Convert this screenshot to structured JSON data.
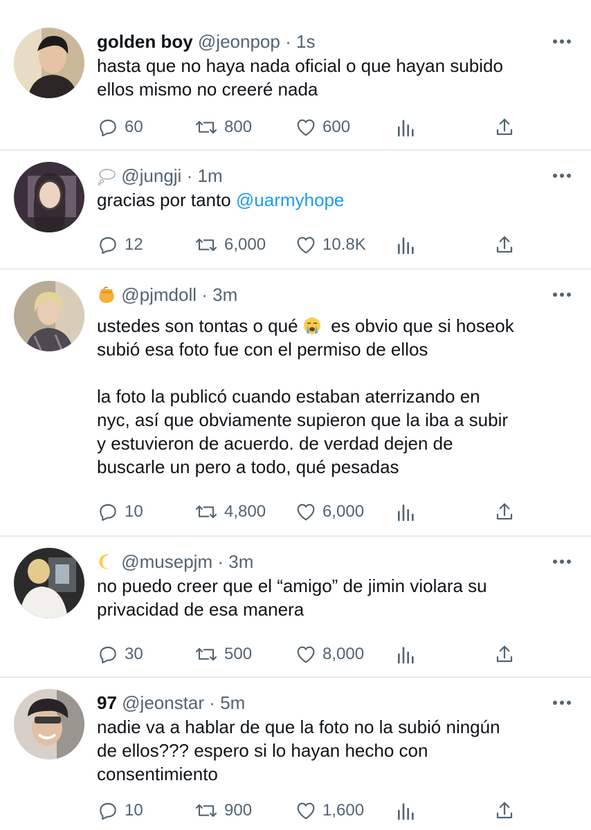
{
  "tweets": [
    {
      "name": "golden boy",
      "name_icon": "",
      "handle": "@jeonpop",
      "dot": "·",
      "time": "1s",
      "text": "hasta que no haya nada oficial o que hayan subido\nellos mismo no creeré nada",
      "mention": "",
      "text2": "",
      "replies": "60",
      "retweets": "800",
      "likes": "600"
    },
    {
      "name": "",
      "name_icon": "thought-balloon-icon",
      "handle": "@jungji",
      "dot": "·",
      "time": "1m",
      "text": "gracias por tanto ",
      "mention": "@uarmyhope",
      "text2": "",
      "replies": "12",
      "retweets": "6,000",
      "likes": "10.8K"
    },
    {
      "name": "",
      "name_icon": "honey-pot-icon",
      "handle": "@pjmdoll",
      "dot": "·",
      "time": "3m",
      "text": "ustedes son tontas o qué ",
      "inline_emoji": "loudly-crying-face-icon",
      "text2": "  es obvio que si hoseok\nsubió esa foto fue con el permiso de ellos\n\nla foto la publicó cuando estaban aterrizando en\nnyc, así que obviamente supieron que la iba a subir\ny estuvieron de acuerdo. de verdad dejen de\nbuscarle un pero a todo, qué pesadas",
      "replies": "10",
      "retweets": "4,800",
      "likes": "6,000"
    },
    {
      "name": "",
      "name_icon": "crescent-moon-icon",
      "handle": "@musepjm",
      "dot": "·",
      "time": "3m",
      "text": "no puedo creer que el “amigo” de jimin violara su\nprivacidad de esa manera",
      "mention": "",
      "text2": "",
      "replies": "30",
      "retweets": "500",
      "likes": "8,000"
    },
    {
      "name": "97",
      "name_icon": "",
      "handle": "@jeonstar",
      "dot": "·",
      "time": "5m",
      "text": "nadie va a hablar de que la foto no la subió ningún\nde ellos??? espero si lo hayan hecho con\nconsentimiento",
      "mention": "",
      "text2": "",
      "replies": "10",
      "retweets": "900",
      "likes": "1,600"
    }
  ],
  "colors": {
    "text": "#0f1419",
    "secondary": "#536471",
    "link": "#1d9bf0",
    "divider": "#e6ecf0"
  }
}
